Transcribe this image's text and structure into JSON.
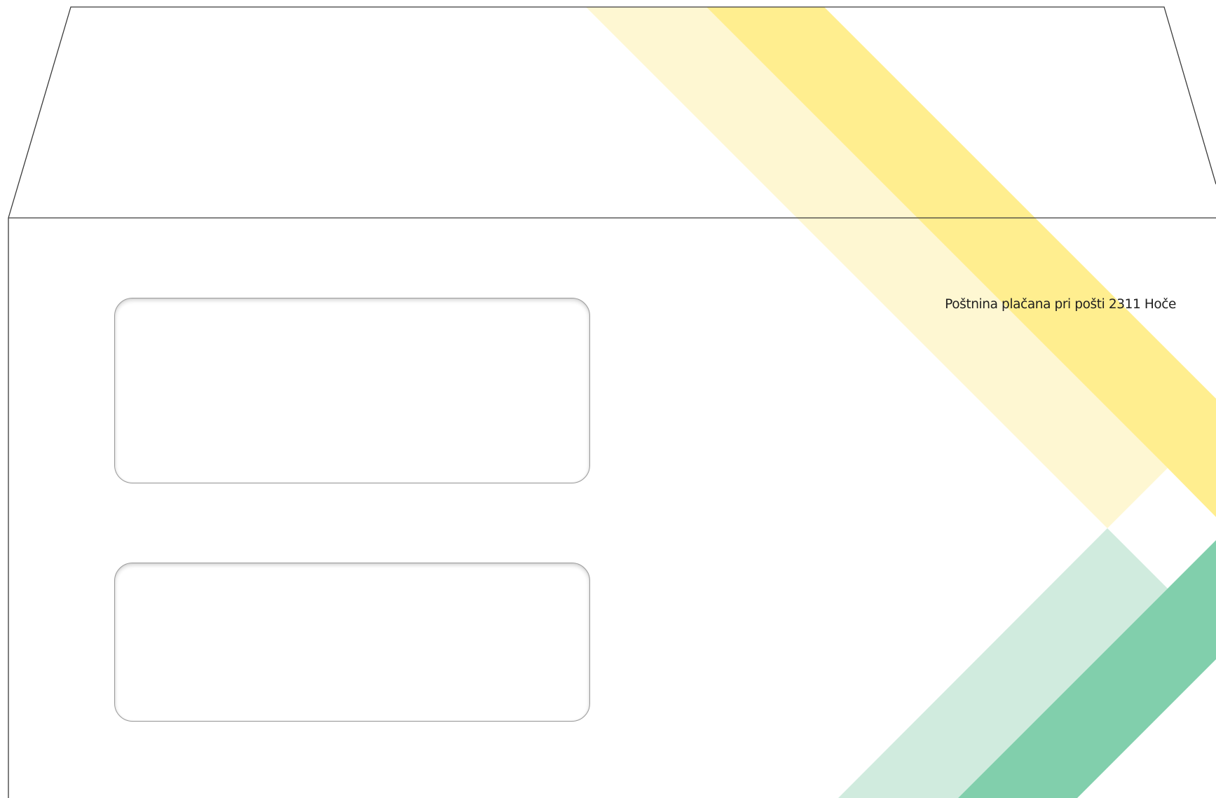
{
  "envelope": {
    "postage_notice": "Poštnina plačana pri pošti 2311 Hoče",
    "colors": {
      "yellow_light": "#FEF7D2",
      "yellow": "#FFEE8F",
      "green_light": "#D0EBDE",
      "green": "#81CFAC",
      "outline": "#3a3a3a",
      "window_border": "#9a9a9a"
    },
    "address_windows": [
      {
        "label": ""
      },
      {
        "label": ""
      }
    ]
  }
}
